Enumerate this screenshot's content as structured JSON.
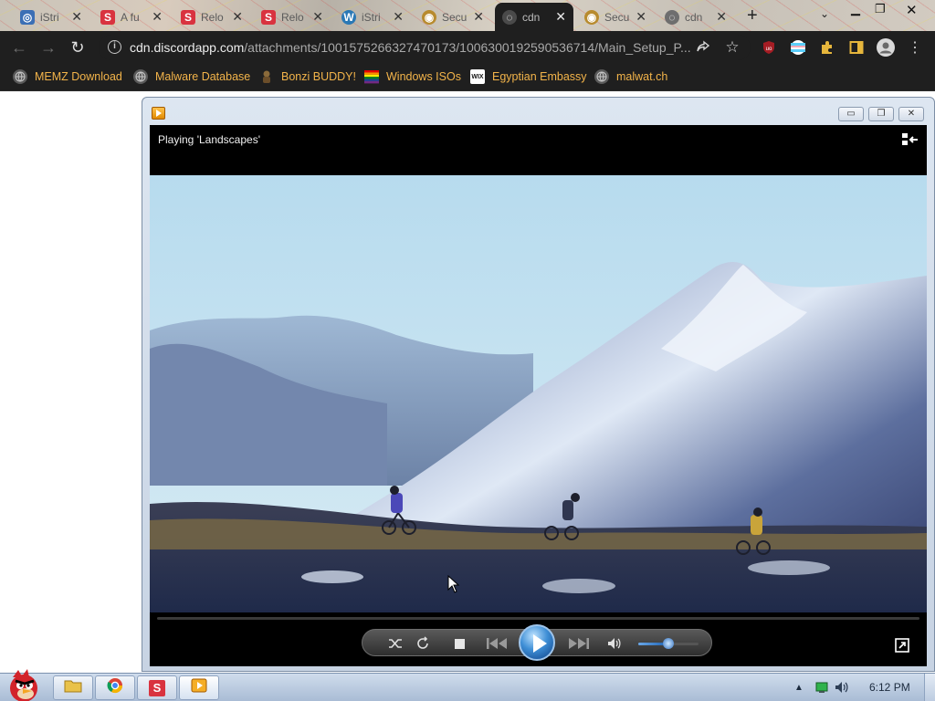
{
  "browser": {
    "tabs": [
      {
        "title": "iStri",
        "favicon": "swirl-favicon",
        "color": "#3b6fb5",
        "glyph": "◎"
      },
      {
        "title": "A fu",
        "favicon": "s-red-favicon",
        "color": "#d9333f",
        "glyph": "S"
      },
      {
        "title": "Relo",
        "favicon": "s-red-favicon",
        "color": "#d9333f",
        "glyph": "S"
      },
      {
        "title": "Relo",
        "favicon": "s-red-favicon",
        "color": "#d9333f",
        "glyph": "S"
      },
      {
        "title": "iStri",
        "favicon": "wordpress-favicon",
        "color": "#2a78b5",
        "glyph": "W"
      },
      {
        "title": "Secu",
        "favicon": "gold-favicon",
        "color": "#b88b2e",
        "glyph": "◉"
      },
      {
        "title": "cdn",
        "favicon": "globe-favicon",
        "color": "#6e6e6e",
        "glyph": "◌"
      },
      {
        "title": "Secu",
        "favicon": "gold-favicon",
        "color": "#b88b2e",
        "glyph": "◉"
      },
      {
        "title": "cdn",
        "favicon": "globe-favicon",
        "color": "#6e6e6e",
        "glyph": "◌"
      }
    ],
    "new_tab_label": "+",
    "address": {
      "host": "cdn.discordapp.com",
      "path": "/attachments/1001575266327470173/1006300192590536714/Main_Setup_P..."
    },
    "bookmarks": [
      {
        "label": "MEMZ Download",
        "icon": "globe-icon"
      },
      {
        "label": "Malware Database",
        "icon": "globe-icon"
      },
      {
        "label": "Bonzi BUDDY!",
        "icon": "bonzi-icon"
      },
      {
        "label": "Windows ISOs",
        "icon": "windows-flag-icon"
      },
      {
        "label": "Egyptian Embassy",
        "icon": "wix-icon"
      },
      {
        "label": "malwat.ch",
        "icon": "globe-icon"
      }
    ],
    "bookmark_color": "#f3b44a"
  },
  "player": {
    "now_playing": "Playing 'Landscapes'",
    "state": "paused",
    "volume_level": 0.5,
    "seek_progress": 0.0,
    "accent_color": "#2f7fd0"
  },
  "taskbar": {
    "clock": "6:12 PM",
    "apps": [
      {
        "name": "explorer",
        "icon": "folder-icon"
      },
      {
        "name": "chrome",
        "icon": "chrome-icon"
      },
      {
        "name": "app-s",
        "icon": "s-red-icon"
      },
      {
        "name": "media-player",
        "icon": "media-player-icon"
      }
    ]
  }
}
